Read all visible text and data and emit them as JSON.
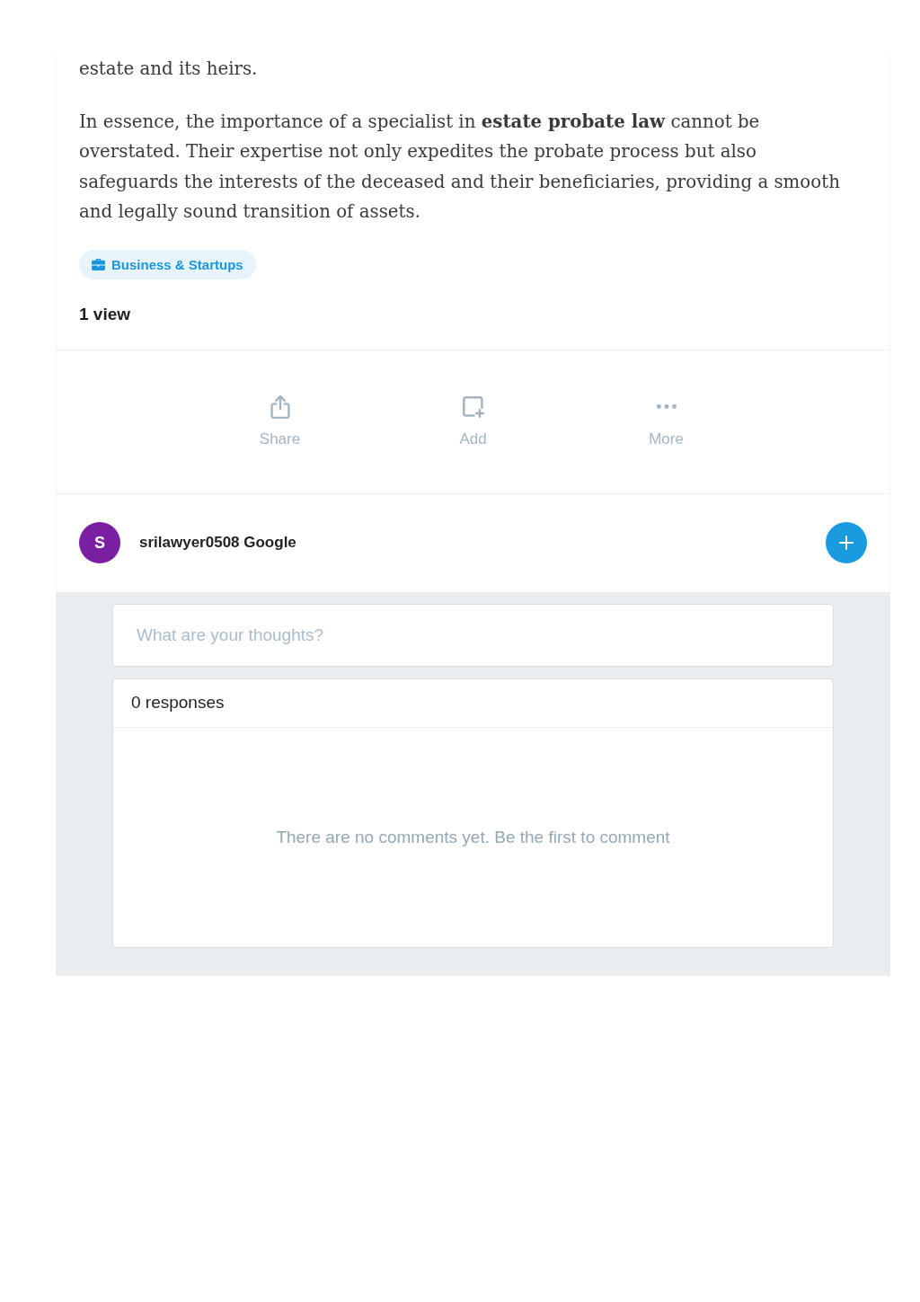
{
  "article": {
    "paragraphs": [
      "estate and its heirs.",
      "In essence, the importance of a specialist in **estate probate law** cannot be overstated. Their expertise not only expedites the probate process but also safeguards the interests of the deceased and their beneficiaries, providing a smooth and legally sound transition of assets."
    ],
    "tag": {
      "label": "Business & Startups"
    },
    "views": "1 view"
  },
  "actions": [
    {
      "kind": "share",
      "label": "Share"
    },
    {
      "kind": "add",
      "label": "Add"
    },
    {
      "kind": "more",
      "label": "More"
    }
  ],
  "author": {
    "initial": "S",
    "name": "srilawyer0508 Google"
  },
  "comments": {
    "input": {
      "placeholder": "What are your thoughts?"
    },
    "count": "0 responses",
    "empty_message": "There are no comments yet. Be the first to comment"
  }
}
